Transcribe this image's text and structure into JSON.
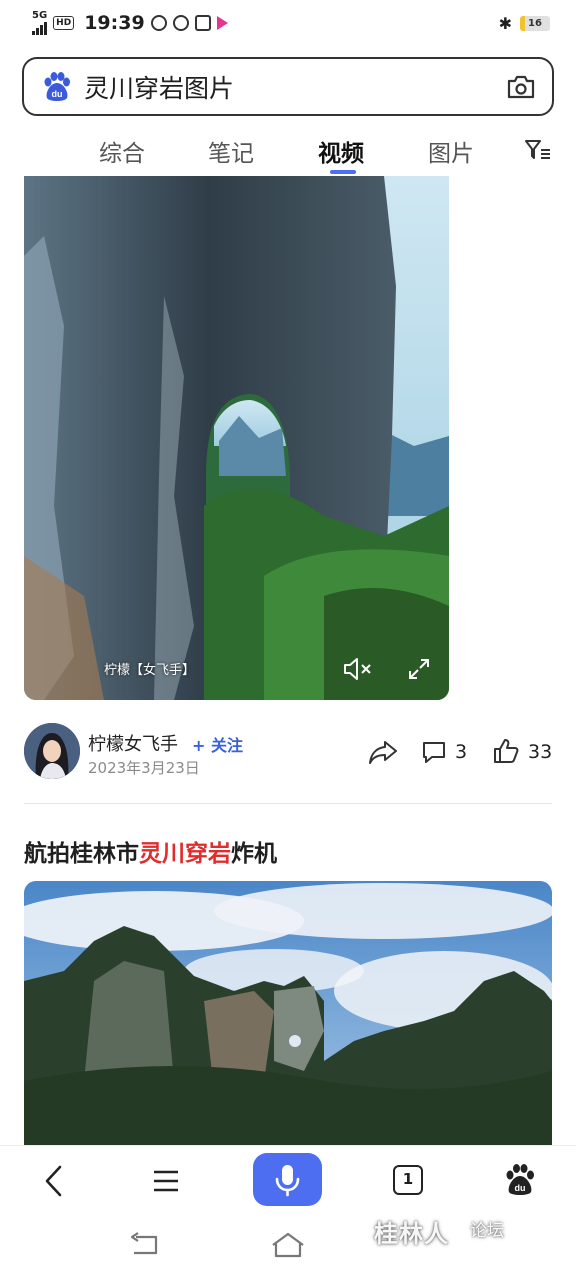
{
  "status_bar": {
    "network": "5G",
    "hd": "HD",
    "time": "19:39",
    "battery_level": "16"
  },
  "search": {
    "query": "灵川穿岩图片"
  },
  "tabs": [
    {
      "label": "综合",
      "active": false
    },
    {
      "label": "笔记",
      "active": false
    },
    {
      "label": "视频",
      "active": true
    },
    {
      "label": "图片",
      "active": false
    }
  ],
  "video": {
    "watermark": "柠檬【女飞手】"
  },
  "author": {
    "name": "柠檬女飞手",
    "follow_label": "+ 关注",
    "date": "2023年3月23日",
    "comment_count": "3",
    "like_count": "33"
  },
  "result": {
    "title_prefix": "航拍桂林市",
    "title_highlight": "灵川穿岩",
    "title_suffix": "炸机"
  },
  "toolbar": {
    "tab_count": "1"
  },
  "watermark": {
    "main": "桂林人",
    "sub": "论坛"
  },
  "colors": {
    "accent": "#4e6ef2",
    "highlight": "#e02c2c",
    "follow": "#3a62d8"
  }
}
